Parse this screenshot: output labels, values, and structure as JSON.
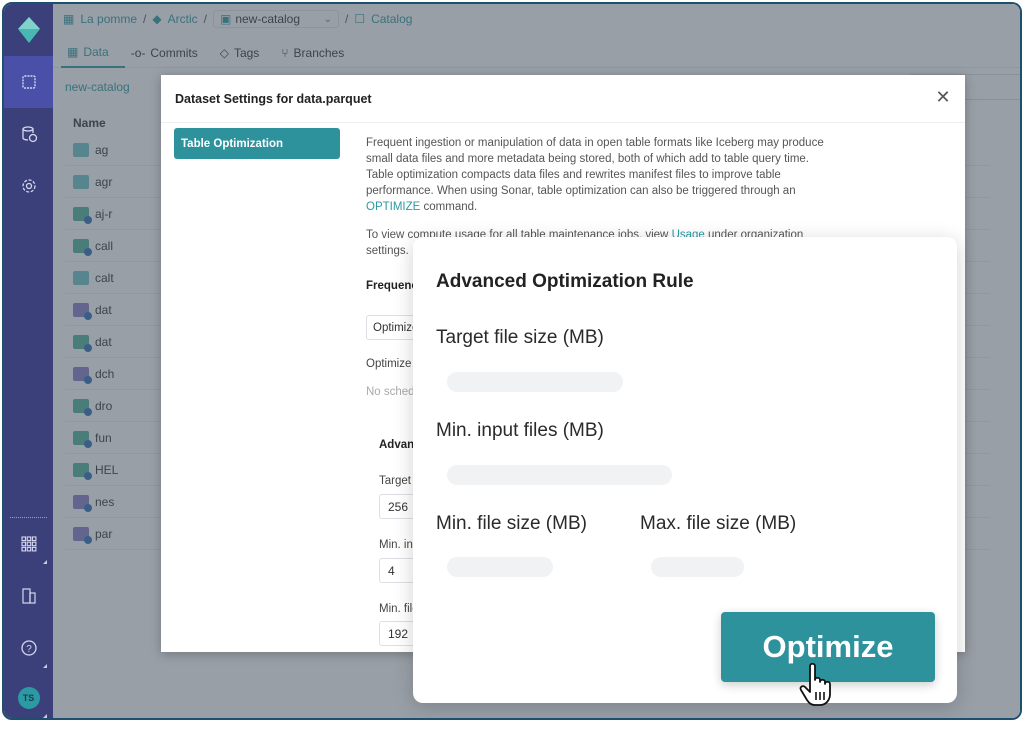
{
  "breadcrumb": {
    "org": "La pomme",
    "project": "Arctic",
    "catalog_select": "new-catalog",
    "section": "Catalog",
    "separator": "/"
  },
  "tabs": [
    {
      "label": "Data",
      "icon": "grid-icon",
      "active": true
    },
    {
      "label": "Commits",
      "icon": "commit-icon",
      "active": false
    },
    {
      "label": "Tags",
      "icon": "tag-icon",
      "active": false
    },
    {
      "label": "Branches",
      "icon": "branch-icon",
      "active": false
    }
  ],
  "namespace_path": "new-catalog",
  "list": {
    "header": "Name",
    "rows": [
      {
        "name": "ag",
        "type": "folder"
      },
      {
        "name": "agr",
        "type": "folder"
      },
      {
        "name": "aj-r",
        "type": "table-iceberg"
      },
      {
        "name": "call",
        "type": "table-iceberg"
      },
      {
        "name": "calt",
        "type": "folder"
      },
      {
        "name": "dat",
        "type": "table-delta"
      },
      {
        "name": "dat",
        "type": "table-iceberg"
      },
      {
        "name": "dch",
        "type": "table-delta"
      },
      {
        "name": "dro",
        "type": "table-iceberg"
      },
      {
        "name": "fun",
        "type": "table-iceberg"
      },
      {
        "name": "HEL",
        "type": "table-iceberg"
      },
      {
        "name": "nes",
        "type": "table-delta"
      },
      {
        "name": "par",
        "type": "table-delta"
      }
    ]
  },
  "sidebar": {
    "items": [
      {
        "name": "logo",
        "icon": "iceberg-logo-icon"
      },
      {
        "name": "catalog",
        "icon": "catalog-icon",
        "active": true
      },
      {
        "name": "datasets",
        "icon": "database-icon"
      },
      {
        "name": "settings",
        "icon": "gear-icon"
      },
      {
        "name": "apps",
        "icon": "grid-apps-icon"
      },
      {
        "name": "organization",
        "icon": "building-icon"
      },
      {
        "name": "help",
        "icon": "help-icon"
      }
    ],
    "avatar_initials": "TS"
  },
  "dialog": {
    "title": "Dataset Settings for data.parquet",
    "nav_item": "Table Optimization",
    "description_1": "Frequent ingestion or manipulation of data in open table formats like Iceberg may produce small data files and more metadata being stored, both of which add to table query time. Table optimization compacts data files and rewrites manifest files to improve table performance. When using Sonar, table optimization can also be triggered through an ",
    "optimize_command": "OPTIMIZE",
    "description_1_end": " command.",
    "description_2": "To view compute usage for all table maintenance jobs, view ",
    "usage_link": "Usage",
    "description_2_end": " under organization settings.",
    "frequency_label": "Frequency to run",
    "optimize_once_button": "Optimize once",
    "optimize_regularly_label": "Optimize regularly",
    "no_schedule": "No schedule yet.",
    "advanced_title": "Advanced confi",
    "fields": [
      {
        "label": "Target file size (",
        "value": "256"
      },
      {
        "label": "Min. input files",
        "value": "4"
      },
      {
        "label": "Min. file size (M",
        "value": "192"
      }
    ]
  },
  "card": {
    "title": "Advanced Optimization Rule",
    "target_label": "Target file size (MB)",
    "min_input_label": "Min. input files (MB)",
    "min_size_label": "Min. file size (MB)",
    "max_size_label": "Max. file size (MB)",
    "button_label": "Optimize"
  },
  "colors": {
    "accent": "#2e929d",
    "sidebar": "#3b3f7a",
    "sidebar_active": "#4a4fa8"
  }
}
